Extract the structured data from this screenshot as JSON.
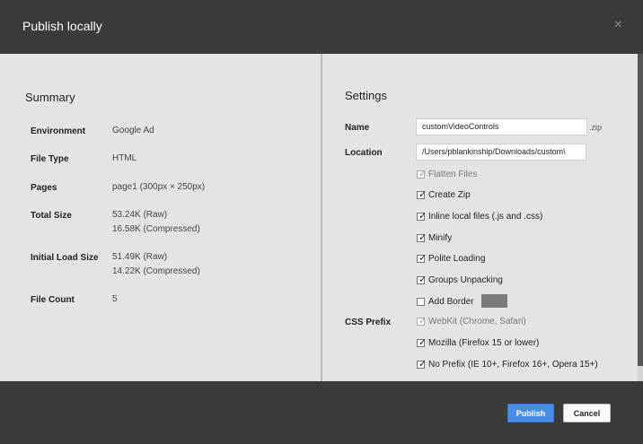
{
  "dialog": {
    "title": "Publish locally",
    "close_label": "×"
  },
  "summary": {
    "heading": "Summary",
    "rows": [
      {
        "label": "Environment",
        "lines": [
          "Google Ad"
        ]
      },
      {
        "label": "File Type",
        "lines": [
          "HTML"
        ]
      },
      {
        "label": "Pages",
        "lines": [
          "page1 (300px × 250px)"
        ]
      },
      {
        "label": "Total Size",
        "lines": [
          "53.24K (Raw)",
          "16.58K (Compressed)"
        ]
      },
      {
        "label": "Initial Load Size",
        "lines": [
          "51.49K (Raw)",
          "14.22K (Compressed)"
        ]
      },
      {
        "label": "File Count",
        "lines": [
          "5"
        ]
      }
    ]
  },
  "settings": {
    "heading": "Settings",
    "name_label": "Name",
    "name_value": "customVideoControls",
    "name_suffix": ".zip",
    "location_label": "Location",
    "location_value": "/Users/pblankinship/Downloads/custom\\",
    "options": [
      {
        "label": "Flatten Files",
        "checked": true,
        "disabled": true
      },
      {
        "label": "Create Zip",
        "checked": true,
        "disabled": false
      },
      {
        "label": "Inline local files (.js and .css)",
        "checked": true,
        "disabled": false
      },
      {
        "label": "Minify",
        "checked": true,
        "disabled": false
      },
      {
        "label": "Polite Loading",
        "checked": true,
        "disabled": false
      },
      {
        "label": "Groups Unpacking",
        "checked": true,
        "disabled": false
      },
      {
        "label": "Add Border",
        "checked": false,
        "disabled": false
      }
    ],
    "border_color": "#7a7a7a",
    "css_prefix_label": "CSS Prefix",
    "css_prefix_options": [
      {
        "label": "WebKit (Chrome, Safari)",
        "checked": true,
        "disabled": true
      },
      {
        "label": "Mozilla (Firefox 15 or lower)",
        "checked": true,
        "disabled": false
      },
      {
        "label": "No Prefix (IE 10+, Firefox 16+, Opera 15+)",
        "checked": true,
        "disabled": false
      }
    ]
  },
  "footer": {
    "publish_label": "Publish",
    "cancel_label": "Cancel"
  },
  "colors": {
    "accent": "#4a8de8",
    "chrome": "#3b3b3b",
    "panel": "#e4e4e4"
  },
  "icons": {
    "close": "close-icon",
    "folder": "folder-icon",
    "checkmark": "checkmark-icon"
  }
}
